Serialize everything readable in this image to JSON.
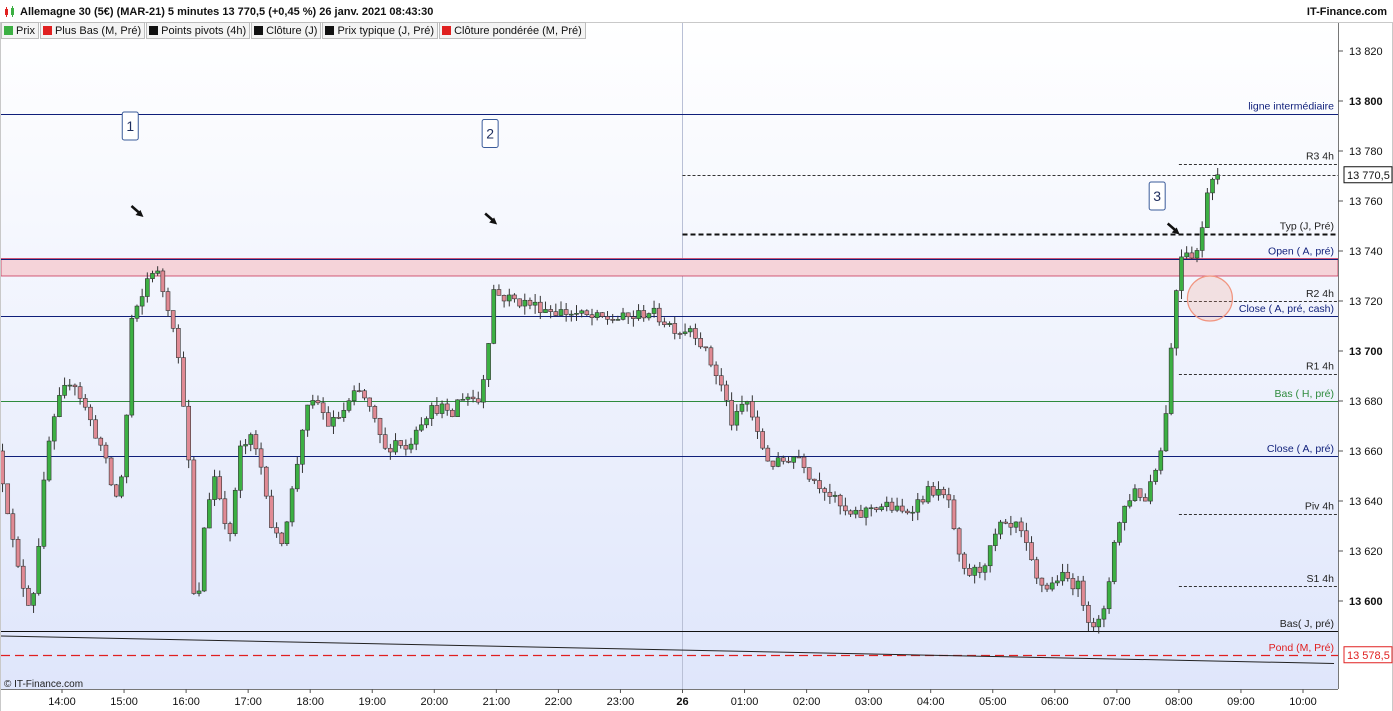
{
  "header": {
    "title": "Allemagne 30 (5€) (MAR-21) 5 minutes 13 770,5 (+0,45 %) 26 janv. 2021 08:43:30",
    "brand": "IT-Finance.com",
    "copyright": "© IT-Finance.com"
  },
  "legend": [
    {
      "label": "Prix",
      "color": "#3cb043"
    },
    {
      "label": "Plus Bas (M, Pré)",
      "color": "#e02020"
    },
    {
      "label": "Points pivots (4h)",
      "color": "#111111"
    },
    {
      "label": "Clôture (J)",
      "color": "#111111"
    },
    {
      "label": "Prix typique (J, Pré)",
      "color": "#111111"
    },
    {
      "label": "Clôture pondérée (M, Pré)",
      "color": "#e02020"
    }
  ],
  "colors": {
    "up": "#3cb043",
    "down": "#e08a94",
    "navy": "#0f1f7a",
    "green_line": "#2e8b3d",
    "red_line": "#e02020",
    "zone_fill": "#f5d3d9",
    "zone_edge": "#c8365a",
    "circle": "#f19580"
  },
  "chart_data": {
    "type": "candlestick",
    "ylim": [
      13570,
      13830
    ],
    "yticks": [
      {
        "value": 13820,
        "label": "13 820",
        "bold": false
      },
      {
        "value": 13800,
        "label": "13 800",
        "bold": true
      },
      {
        "value": 13780,
        "label": "13 780",
        "bold": false
      },
      {
        "value": 13760,
        "label": "13 760",
        "bold": false
      },
      {
        "value": 13740,
        "label": "13 740",
        "bold": false
      },
      {
        "value": 13720,
        "label": "13 720",
        "bold": false
      },
      {
        "value": 13700,
        "label": "13 700",
        "bold": true
      },
      {
        "value": 13680,
        "label": "13 680",
        "bold": false
      },
      {
        "value": 13660,
        "label": "13 660",
        "bold": false
      },
      {
        "value": 13640,
        "label": "13 640",
        "bold": false
      },
      {
        "value": 13620,
        "label": "13 620",
        "bold": false
      },
      {
        "value": 13600,
        "label": "13 600",
        "bold": true
      }
    ],
    "xticks": [
      {
        "hour": 14,
        "label": "14:00"
      },
      {
        "hour": 15,
        "label": "15:00"
      },
      {
        "hour": 16,
        "label": "16:00"
      },
      {
        "hour": 17,
        "label": "17:00"
      },
      {
        "hour": 18,
        "label": "18:00"
      },
      {
        "hour": 19,
        "label": "19:00"
      },
      {
        "hour": 20,
        "label": "20:00"
      },
      {
        "hour": 21,
        "label": "21:00"
      },
      {
        "hour": 22,
        "label": "22:00"
      },
      {
        "hour": 23,
        "label": "23:00"
      },
      {
        "hour": 24,
        "label": "26",
        "bold": true
      },
      {
        "hour": 25,
        "label": "01:00"
      },
      {
        "hour": 26,
        "label": "02:00"
      },
      {
        "hour": 27,
        "label": "03:00"
      },
      {
        "hour": 28,
        "label": "04:00"
      },
      {
        "hour": 29,
        "label": "05:00"
      },
      {
        "hour": 30,
        "label": "06:00"
      },
      {
        "hour": 31,
        "label": "07:00"
      },
      {
        "hour": 32,
        "label": "08:00"
      },
      {
        "hour": 33,
        "label": "09:00"
      },
      {
        "hour": 34,
        "label": "10:00"
      }
    ],
    "day_separator_hour": 24,
    "price_tags": [
      {
        "value": 13770.5,
        "label": "13 770,5",
        "color": "#111111"
      },
      {
        "value": 13578.5,
        "label": "13 578,5",
        "color": "#e02020"
      }
    ],
    "levels": [
      {
        "value": 13795,
        "label": "ligne intermédiaire",
        "style": "solid-navy",
        "from_hour": 13.0
      },
      {
        "value": 13775,
        "label": "R3 4h",
        "style": "dotted",
        "from_hour": 32.0
      },
      {
        "value": 13770.5,
        "label": "",
        "style": "dotted-last",
        "from_hour": 24.0
      },
      {
        "value": 13747,
        "label": "Typ (J, Pré)",
        "style": "thick-dash",
        "from_hour": 24.0
      },
      {
        "value": 13737,
        "label": "Open ( A, pré)",
        "style": "zone-top",
        "from_hour": 13.0
      },
      {
        "value": 13720,
        "label": "R2 4h",
        "style": "dotted",
        "from_hour": 32.0
      },
      {
        "value": 13714,
        "label": "Close ( A, pré, cash)",
        "style": "solid-navy",
        "from_hour": 13.0
      },
      {
        "value": 13691,
        "label": "R1 4h",
        "style": "dotted",
        "from_hour": 32.0
      },
      {
        "value": 13680,
        "label": "Bas ( H, pré)",
        "style": "solid-green",
        "from_hour": 13.0
      },
      {
        "value": 13658,
        "label": "Close ( A, pré)",
        "style": "solid-navy",
        "from_hour": 13.0
      },
      {
        "value": 13635,
        "label": "Piv 4h",
        "style": "dotted",
        "from_hour": 32.0
      },
      {
        "value": 13606,
        "label": "S1 4h",
        "style": "dotted",
        "from_hour": 32.0
      },
      {
        "value": 13588,
        "label": "Bas( J, pré)",
        "style": "solid-black",
        "from_hour": 13.0
      },
      {
        "value": 13578.5,
        "label": "Pond (M, Pré)",
        "style": "dash-red",
        "from_hour": 13.0
      }
    ],
    "zone": {
      "from": 13730,
      "to": 13737
    },
    "trendline": {
      "from_hour": 13.0,
      "from_value": 13586,
      "to_hour": 34.5,
      "to_value": 13575
    },
    "annotations": [
      {
        "text": "1",
        "hour": 15.1,
        "value": 13790,
        "arrow_hour": 15.2,
        "arrow_value": 13756
      },
      {
        "text": "2",
        "hour": 20.9,
        "value": 13787,
        "arrow_hour": 20.9,
        "arrow_value": 13753
      },
      {
        "text": "3",
        "hour": 31.65,
        "value": 13762,
        "arrow_hour": 31.9,
        "arrow_value": 13749
      }
    ],
    "circle": {
      "hour": 32.5,
      "value": 13721,
      "radius_value": 9
    },
    "anchors": [
      [
        13.0,
        13660
      ],
      [
        13.15,
        13640
      ],
      [
        13.3,
        13615
      ],
      [
        13.5,
        13600
      ],
      [
        13.6,
        13605
      ],
      [
        13.8,
        13660
      ],
      [
        14.0,
        13680
      ],
      [
        14.2,
        13690
      ],
      [
        14.5,
        13672
      ],
      [
        14.7,
        13660
      ],
      [
        14.9,
        13640
      ],
      [
        15.05,
        13655
      ],
      [
        15.15,
        13712
      ],
      [
        15.3,
        13718
      ],
      [
        15.45,
        13732
      ],
      [
        15.55,
        13733
      ],
      [
        15.7,
        13722
      ],
      [
        15.85,
        13710
      ],
      [
        16.0,
        13680
      ],
      [
        16.1,
        13650
      ],
      [
        16.15,
        13605
      ],
      [
        16.22,
        13593
      ],
      [
        16.35,
        13635
      ],
      [
        16.5,
        13650
      ],
      [
        16.6,
        13640
      ],
      [
        16.75,
        13625
      ],
      [
        16.9,
        13660
      ],
      [
        17.1,
        13665
      ],
      [
        17.3,
        13650
      ],
      [
        17.45,
        13625
      ],
      [
        17.6,
        13625
      ],
      [
        17.8,
        13650
      ],
      [
        17.95,
        13675
      ],
      [
        18.15,
        13680
      ],
      [
        18.35,
        13670
      ],
      [
        18.55,
        13675
      ],
      [
        18.7,
        13680
      ],
      [
        18.8,
        13684
      ],
      [
        18.95,
        13680
      ],
      [
        19.1,
        13670
      ],
      [
        19.25,
        13660
      ],
      [
        19.45,
        13665
      ],
      [
        19.6,
        13660
      ],
      [
        19.75,
        13670
      ],
      [
        19.95,
        13676
      ],
      [
        20.15,
        13678
      ],
      [
        20.3,
        13672
      ],
      [
        20.45,
        13682
      ],
      [
        20.6,
        13682
      ],
      [
        20.75,
        13680
      ],
      [
        20.8,
        13685
      ],
      [
        20.9,
        13700
      ],
      [
        20.98,
        13725
      ],
      [
        21.1,
        13722
      ],
      [
        21.4,
        13720
      ],
      [
        21.7,
        13718
      ],
      [
        22.0,
        13716
      ],
      [
        22.3,
        13715
      ],
      [
        22.6,
        13713
      ],
      [
        22.9,
        13713
      ],
      [
        23.1,
        13713
      ],
      [
        23.3,
        13714
      ],
      [
        23.5,
        13716
      ],
      [
        23.75,
        13712
      ],
      [
        24.0,
        13708
      ],
      [
        24.2,
        13710
      ],
      [
        24.4,
        13700
      ],
      [
        24.6,
        13690
      ],
      [
        24.7,
        13684
      ],
      [
        24.85,
        13670
      ],
      [
        25.0,
        13678
      ],
      [
        25.1,
        13680
      ],
      [
        25.25,
        13666
      ],
      [
        25.45,
        13655
      ],
      [
        25.6,
        13655
      ],
      [
        25.8,
        13658
      ],
      [
        25.95,
        13658
      ],
      [
        26.1,
        13650
      ],
      [
        26.35,
        13645
      ],
      [
        26.5,
        13640
      ],
      [
        26.7,
        13634
      ],
      [
        26.9,
        13634
      ],
      [
        27.1,
        13638
      ],
      [
        27.35,
        13638
      ],
      [
        27.6,
        13635
      ],
      [
        27.85,
        13640
      ],
      [
        28.05,
        13645
      ],
      [
        28.2,
        13642
      ],
      [
        28.35,
        13640
      ],
      [
        28.45,
        13620
      ],
      [
        28.6,
        13610
      ],
      [
        28.85,
        13613
      ],
      [
        29.0,
        13620
      ],
      [
        29.15,
        13630
      ],
      [
        29.3,
        13628
      ],
      [
        29.45,
        13630
      ],
      [
        29.6,
        13620
      ],
      [
        29.75,
        13608
      ],
      [
        29.95,
        13605
      ],
      [
        30.1,
        13610
      ],
      [
        30.3,
        13608
      ],
      [
        30.45,
        13605
      ],
      [
        30.55,
        13595
      ],
      [
        30.7,
        13590
      ],
      [
        30.82,
        13593
      ],
      [
        30.9,
        13605
      ],
      [
        31.0,
        13625
      ],
      [
        31.2,
        13640
      ],
      [
        31.35,
        13645
      ],
      [
        31.5,
        13640
      ],
      [
        31.6,
        13650
      ],
      [
        31.75,
        13660
      ],
      [
        31.85,
        13680
      ],
      [
        31.93,
        13705
      ],
      [
        32.0,
        13725
      ],
      [
        32.1,
        13742
      ],
      [
        32.2,
        13740
      ],
      [
        32.3,
        13738
      ],
      [
        32.4,
        13745
      ],
      [
        32.5,
        13765
      ],
      [
        32.6,
        13770.5
      ]
    ]
  }
}
